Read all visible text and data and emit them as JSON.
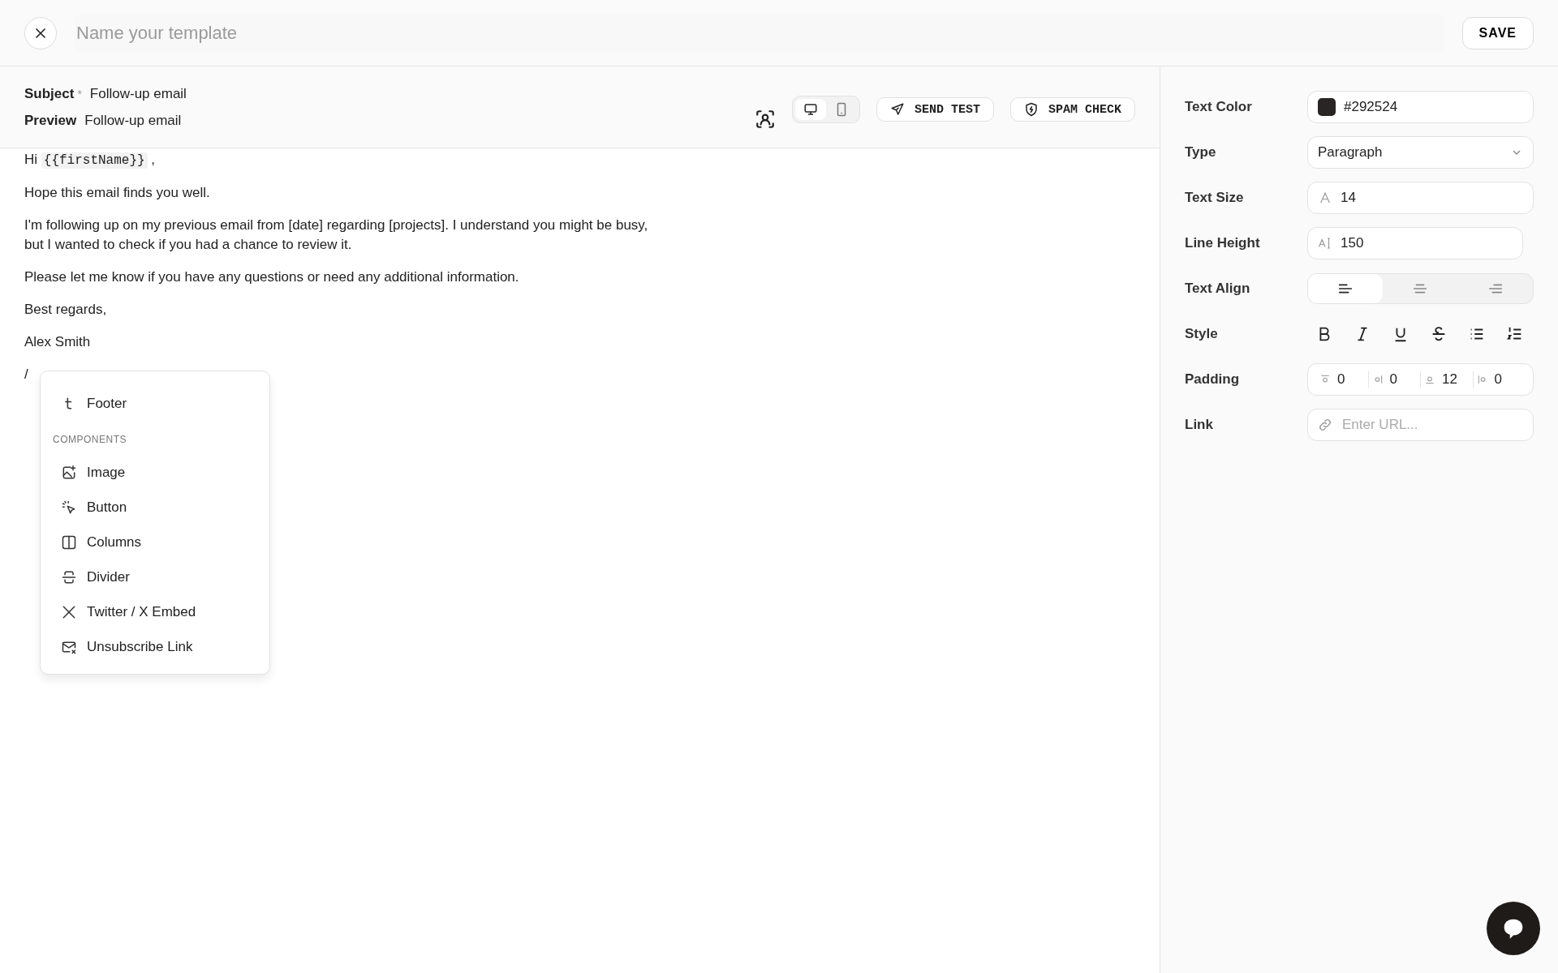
{
  "header": {
    "title_placeholder": "Name your template",
    "save": "SAVE"
  },
  "meta": {
    "subject": {
      "label": "Subject",
      "required": "*",
      "value": "Follow-up email"
    },
    "preview": {
      "label": "Preview",
      "value": "Follow-up email"
    }
  },
  "toolbar": {
    "devices": [
      {
        "kind": "desktop",
        "selected": true
      },
      {
        "kind": "mobile",
        "selected": false
      }
    ],
    "buttons": [
      {
        "kind": "send",
        "label": "SEND TEST"
      },
      {
        "kind": "spam",
        "label": "SPAM CHECK"
      }
    ]
  },
  "body": [
    {
      "kind": "greeting",
      "text": "Hi",
      "token": "{{firstName}}",
      "after": ","
    },
    {
      "kind": "text",
      "text": "Hope this email finds you well."
    },
    {
      "kind": "text",
      "text": "I'm following up on my previous email from [date] regarding [projects]. I understand you might be busy, but I wanted to check if you had a chance to review it."
    },
    {
      "kind": "text",
      "text": "Please let me know if you have any questions or need any additional information."
    },
    {
      "kind": "text",
      "text": "Best regards,"
    },
    {
      "kind": "text",
      "text": "Alex Smith"
    },
    {
      "kind": "text",
      "text": "/"
    }
  ],
  "menu": {
    "top_items": [
      "Footer"
    ],
    "section": "COMPONENTS",
    "items": [
      "Image",
      "Button",
      "Columns",
      "Divider",
      "Twitter / X Embed",
      "Unsubscribe Link"
    ]
  },
  "properties": [
    {
      "kind": "color",
      "label": "Text Color",
      "value": "#292524",
      "color": "#292524"
    },
    {
      "kind": "select",
      "label": "Type",
      "value": "Paragraph"
    },
    {
      "kind": "size",
      "label": "Text Size",
      "value": "14"
    },
    {
      "kind": "lineheight",
      "label": "Line Height",
      "value": "150"
    },
    {
      "kind": "align",
      "label": "Text Align",
      "options": [
        {
          "kind": "left",
          "selected": true
        },
        {
          "kind": "center",
          "selected": false
        },
        {
          "kind": "right",
          "selected": false
        }
      ]
    },
    {
      "kind": "style",
      "label": "Style"
    },
    {
      "kind": "padding",
      "label": "Padding",
      "values": [
        "0",
        "0",
        "12",
        "0"
      ]
    },
    {
      "kind": "link",
      "label": "Link",
      "placeholder": "Enter URL..."
    }
  ]
}
